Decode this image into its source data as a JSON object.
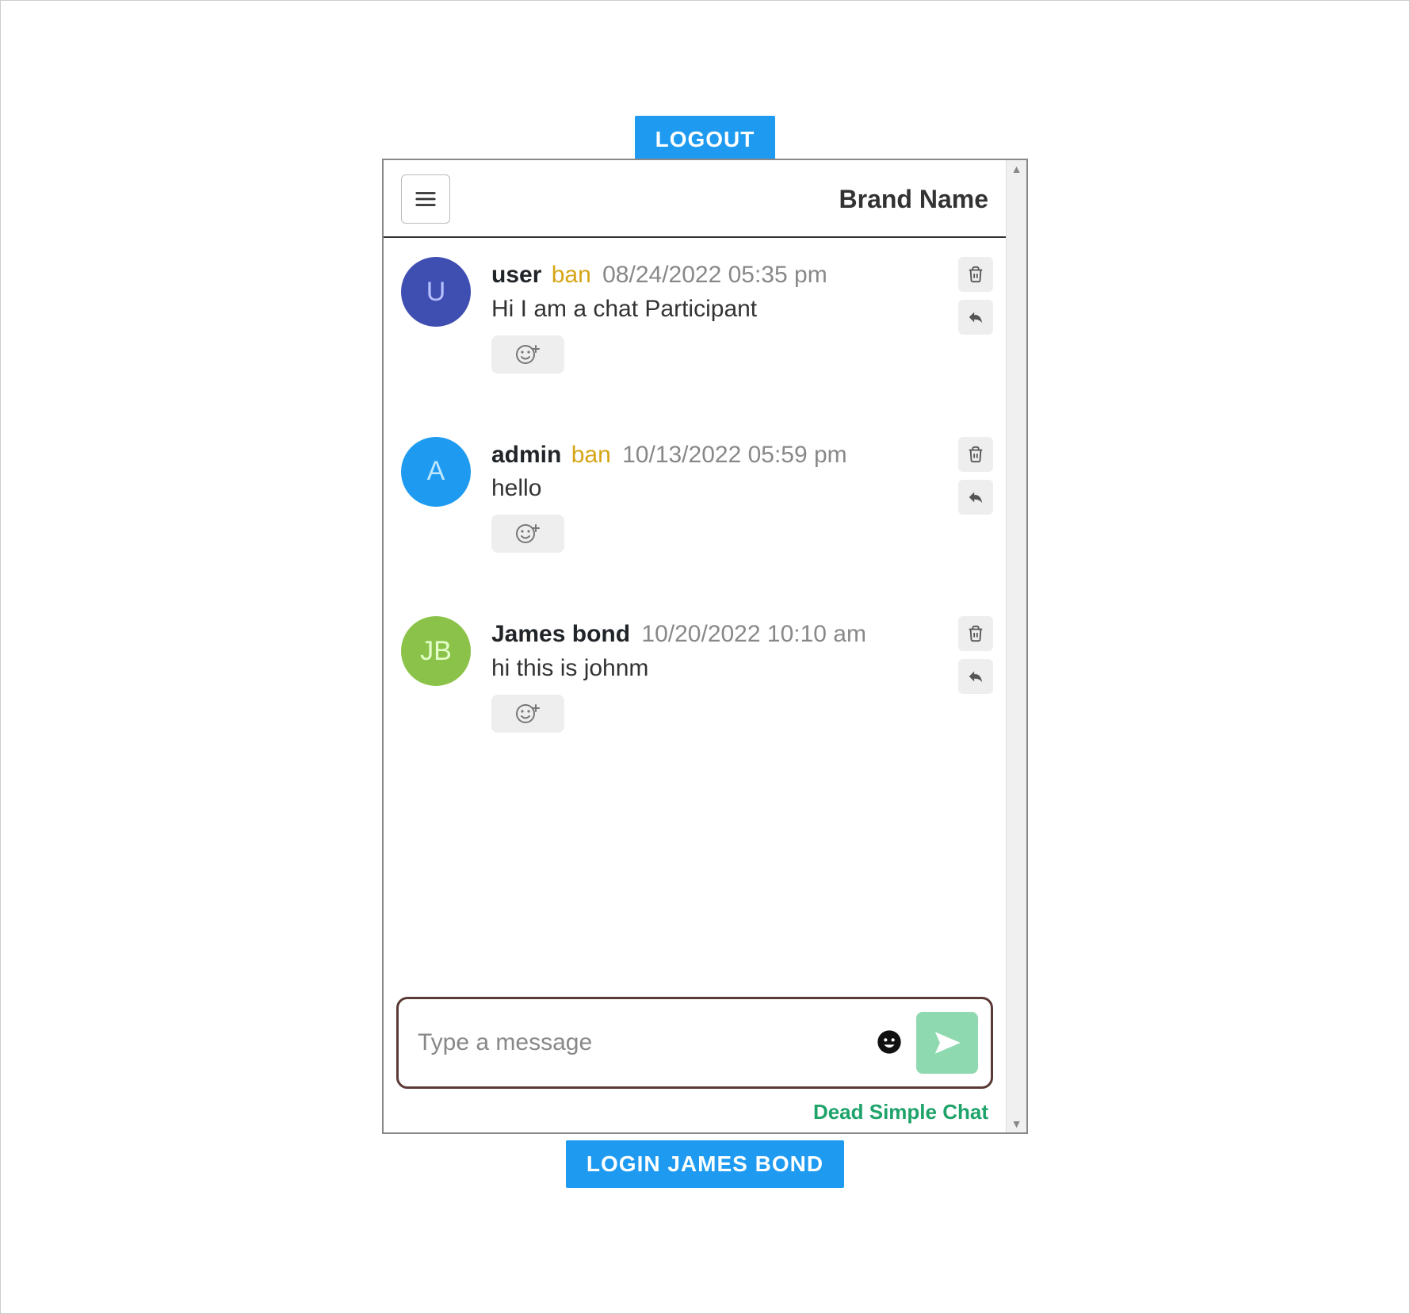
{
  "buttons": {
    "logout": "LOGOUT",
    "login": "LOGIN JAMES BOND"
  },
  "header": {
    "brand": "Brand Name",
    "menu_icon": "hamburger-icon"
  },
  "composer": {
    "placeholder": "Type a message",
    "emoji_icon": "smile-icon",
    "send_icon": "paper-plane-icon"
  },
  "footer": {
    "link": "Dead Simple Chat"
  },
  "messages": [
    {
      "avatar_initials": "U",
      "avatar_bg": "#3f4fb1",
      "avatar_fg": "#b6c0ff",
      "username": "user",
      "ban_label": "ban",
      "timestamp": "08/24/2022 05:35 pm",
      "text": "Hi I am a chat Participant"
    },
    {
      "avatar_initials": "A",
      "avatar_bg": "#1e9bf0",
      "avatar_fg": "#bfe8ff",
      "username": "admin",
      "ban_label": "ban",
      "timestamp": "10/13/2022 05:59 pm",
      "text": "hello"
    },
    {
      "avatar_initials": "JB",
      "avatar_bg": "#8bc34a",
      "avatar_fg": "#e4ffc9",
      "username": "James bond",
      "ban_label": "",
      "timestamp": "10/20/2022 10:10 am",
      "text": "hi this is johnm"
    }
  ],
  "icons": {
    "trash": "trash-icon",
    "reply": "reply-icon",
    "react": "smile-plus-icon"
  }
}
